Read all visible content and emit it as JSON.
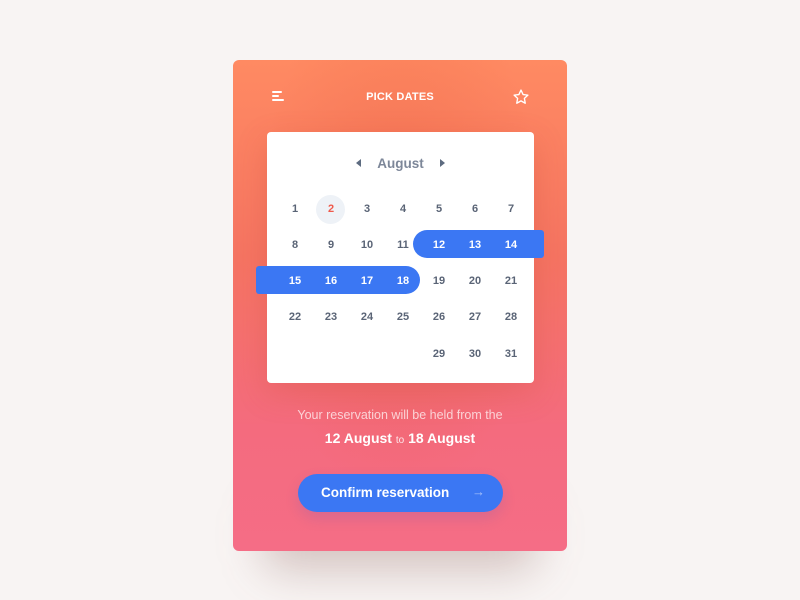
{
  "header": {
    "title": "PICK DATES",
    "menu_icon": "hamburger-menu-icon",
    "favorite_icon": "star-icon"
  },
  "calendar": {
    "month": "August",
    "prev_icon": "caret-left-icon",
    "next_icon": "caret-right-icon",
    "today": 2,
    "range_start": 12,
    "range_end": 18,
    "weeks": [
      [
        "1",
        "2",
        "3",
        "4",
        "5",
        "6",
        "7"
      ],
      [
        "8",
        "9",
        "10",
        "11",
        "12",
        "13",
        "14"
      ],
      [
        "15",
        "16",
        "17",
        "18",
        "19",
        "20",
        "21"
      ],
      [
        "22",
        "23",
        "24",
        "25",
        "26",
        "27",
        "28"
      ],
      [
        "",
        "",
        "",
        "",
        "29",
        "30",
        "31"
      ]
    ]
  },
  "summary": {
    "note": "Your reservation will be held from the",
    "start": "12 August",
    "connector": "to",
    "end": "18 August"
  },
  "confirm": {
    "label": "Confirm reservation",
    "arrow": "→"
  },
  "colors": {
    "accent": "#3b77f3",
    "today": "#ef5a4c",
    "gradient_top": "#ff8a62",
    "gradient_bottom": "#f56d86"
  }
}
